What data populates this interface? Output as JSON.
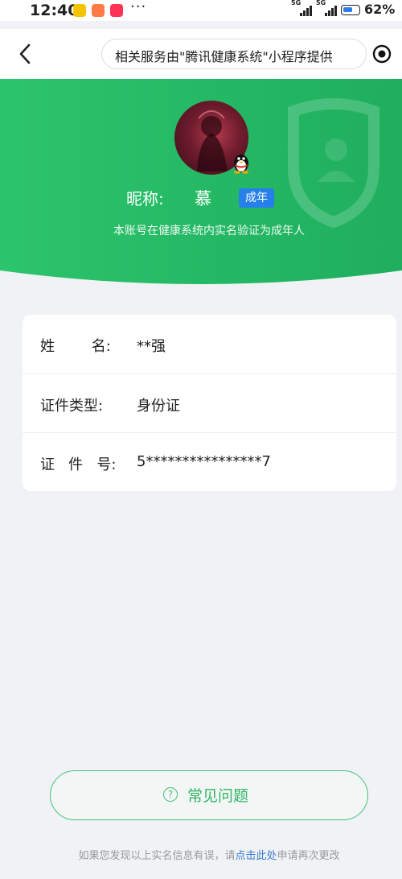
{
  "status_bar": {
    "time": "12:40",
    "signal_1_label": "5G",
    "signal_2_label": "5G",
    "battery_percent": "62%",
    "battery_level": 0.62,
    "overflow": "···"
  },
  "nav": {
    "title": "相关服务由\"腾讯健康系统\"小程序提供"
  },
  "profile": {
    "nickname_label": "昵称:",
    "nickname": "慕",
    "badge": "成年",
    "verify_note": "本账号在健康系统内实名验证为成年人"
  },
  "info": [
    {
      "label": "姓        名:",
      "value": "**强"
    },
    {
      "label": "证件类型:",
      "value": "身份证"
    },
    {
      "label": "证   件   号:",
      "value": "5****************7"
    }
  ],
  "faq": {
    "icon": "?",
    "label": "常见问题"
  },
  "footer": {
    "prefix": "如果您发现以上实名信息有误，请",
    "link": "点击此处",
    "suffix": "申请再次更改"
  },
  "colors": {
    "green_primary": "#2fc26f",
    "green_dark": "#1fae5e",
    "badge_blue": "#2680eb",
    "link_blue": "#3a7bd5",
    "page_bg": "#f0f2f5"
  }
}
